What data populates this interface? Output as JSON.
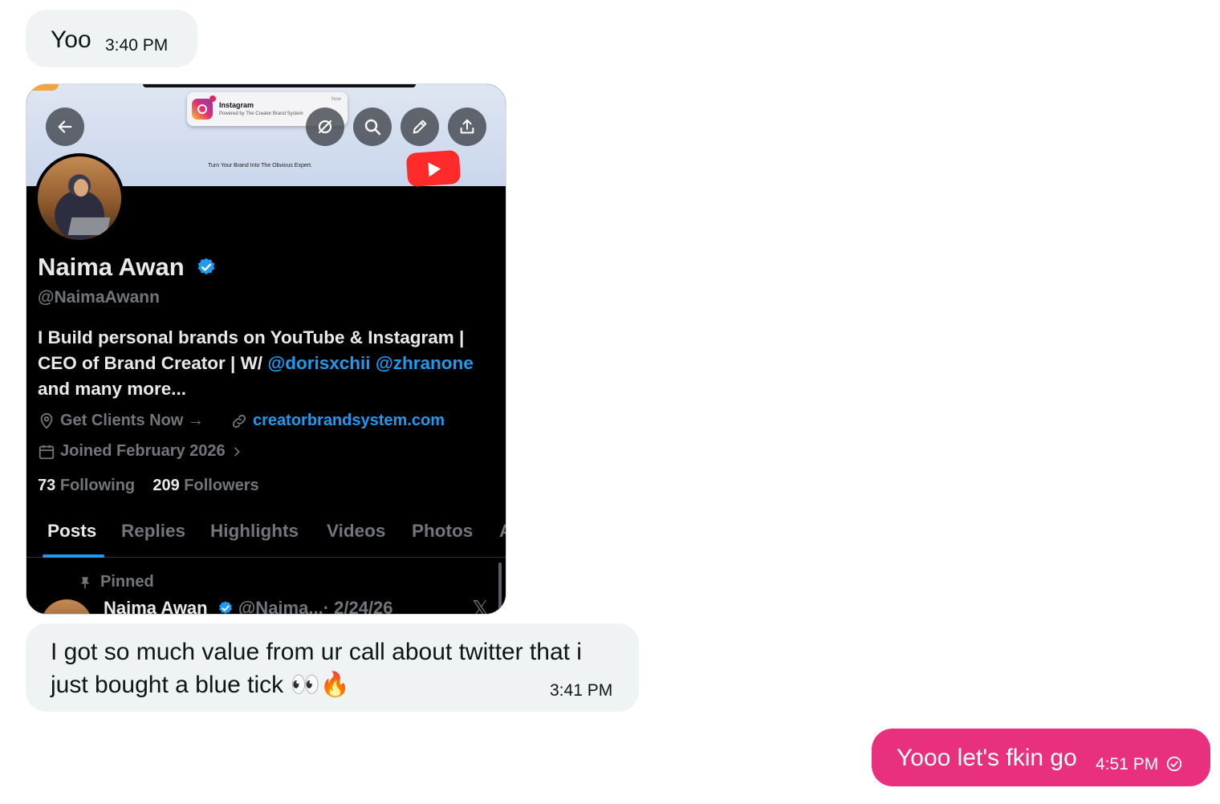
{
  "messages": [
    {
      "text": "Yoo",
      "time": "3:40 PM",
      "direction": "incoming"
    },
    {
      "text": "I got so much value from ur call about twitter that i just bought a blue tick 👀🔥",
      "time": "3:41 PM",
      "direction": "incoming"
    },
    {
      "text": "Yooo let's fkin go",
      "time": "4:51 PM",
      "direction": "outgoing",
      "status_icon": "sent-check-icon"
    }
  ],
  "attachment": {
    "banner": {
      "notification_app": "Instagram",
      "notification_sub": "Powered by The Creator Brand System",
      "notification_time": "Now",
      "tagline": "Turn Your Brand Into The Obvious Expert."
    },
    "profile": {
      "name": "Naima Awan",
      "handle": "@NaimaAwann",
      "bio_line1": "I Build personal brands on YouTube & Instagram |",
      "bio_line2_prefix": "CEO of Brand Creator | W/ ",
      "mention1": "@dorisxchii",
      "mention2": "@zhranone",
      "bio_line3": "and many more...",
      "location": "Get Clients Now →",
      "website": "creatorbrandsystem.com",
      "joined": "Joined February 2026",
      "following_count": "73",
      "following_label": "Following",
      "followers_count": "209",
      "followers_label": "Followers"
    },
    "tabs": [
      "Posts",
      "Replies",
      "Highlights",
      "Videos",
      "Photos",
      "A"
    ],
    "pinned_label": "Pinned",
    "post_author": "Naima Awan",
    "post_handle": "@Naima...",
    "post_date": "· 2/24/26"
  },
  "colors": {
    "incoming_bubble": "#eff3f4",
    "outgoing_bubble": "#e8307e",
    "link_blue": "#1d9bf0",
    "dim_text": "#71767b"
  }
}
